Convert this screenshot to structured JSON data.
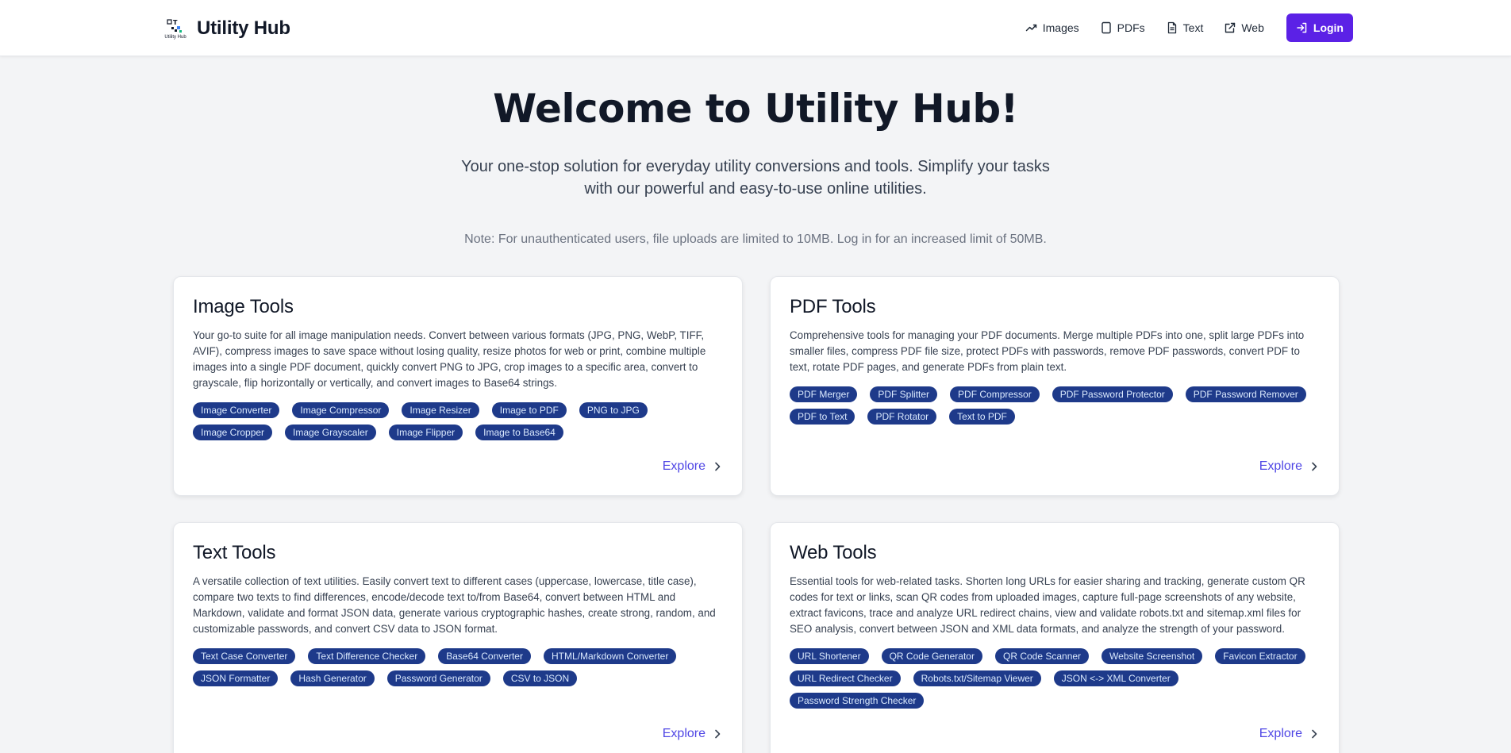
{
  "brand": {
    "logo_text": "Utility Hub",
    "name": "Utility Hub"
  },
  "nav": {
    "items": [
      {
        "label": "Images",
        "icon": "trend-icon"
      },
      {
        "label": "PDFs",
        "icon": "document-outline-icon"
      },
      {
        "label": "Text",
        "icon": "file-text-icon"
      },
      {
        "label": "Web",
        "icon": "external-link-icon"
      }
    ],
    "login": {
      "label": "Login",
      "icon": "login-icon"
    }
  },
  "hero": {
    "title": "Welcome to Utility Hub!",
    "subtitle": "Your one-stop solution for everyday utility conversions and tools. Simplify your tasks with our powerful and easy-to-use online utilities.",
    "note": "Note: For unauthenticated users, file uploads are limited to 10MB. Log in for an increased limit of 50MB."
  },
  "cards": [
    {
      "title": "Image Tools",
      "description": "Your go-to suite for all image manipulation needs. Convert between various formats (JPG, PNG, WebP, TIFF, AVIF), compress images to save space without losing quality, resize photos for web or print, combine multiple images into a single PDF document, quickly convert PNG to JPG, crop images to a specific area, convert to grayscale, flip horizontally or vertically, and convert images to Base64 strings.",
      "tags": [
        "Image Converter",
        "Image Compressor",
        "Image Resizer",
        "Image to PDF",
        "PNG to JPG",
        "Image Cropper",
        "Image Grayscaler",
        "Image Flipper",
        "Image to Base64"
      ],
      "explore": "Explore"
    },
    {
      "title": "PDF Tools",
      "description": "Comprehensive tools for managing your PDF documents. Merge multiple PDFs into one, split large PDFs into smaller files, compress PDF file size, protect PDFs with passwords, remove PDF passwords, convert PDF to text, rotate PDF pages, and generate PDFs from plain text.",
      "tags": [
        "PDF Merger",
        "PDF Splitter",
        "PDF Compressor",
        "PDF Password Protector",
        "PDF Password Remover",
        "PDF to Text",
        "PDF Rotator",
        "Text to PDF"
      ],
      "explore": "Explore"
    },
    {
      "title": "Text Tools",
      "description": "A versatile collection of text utilities. Easily convert text to different cases (uppercase, lowercase, title case), compare two texts to find differences, encode/decode text to/from Base64, convert between HTML and Markdown, validate and format JSON data, generate various cryptographic hashes, create strong, random, and customizable passwords, and convert CSV data to JSON format.",
      "tags": [
        "Text Case Converter",
        "Text Difference Checker",
        "Base64 Converter",
        "HTML/Markdown Converter",
        "JSON Formatter",
        "Hash Generator",
        "Password Generator",
        "CSV to JSON"
      ],
      "explore": "Explore"
    },
    {
      "title": "Web Tools",
      "description": "Essential tools for web-related tasks. Shorten long URLs for easier sharing and tracking, generate custom QR codes for text or links, scan QR codes from uploaded images, capture full-page screenshots of any website, extract favicons, trace and analyze URL redirect chains, view and validate robots.txt and sitemap.xml files for SEO analysis, convert between JSON and XML data formats, and analyze the strength of your password.",
      "tags": [
        "URL Shortener",
        "QR Code Generator",
        "QR Code Scanner",
        "Website Screenshot",
        "Favicon Extractor",
        "URL Redirect Checker",
        "Robots.txt/Sitemap Viewer",
        "JSON <-> XML Converter",
        "Password Strength Checker"
      ],
      "explore": "Explore"
    }
  ],
  "colors": {
    "accent": "#5b21e6",
    "tag_bg": "#1e3a8a",
    "tag_text": "#dbeafe",
    "link": "#4f46e5",
    "page_bg": "#f3f4f6"
  }
}
